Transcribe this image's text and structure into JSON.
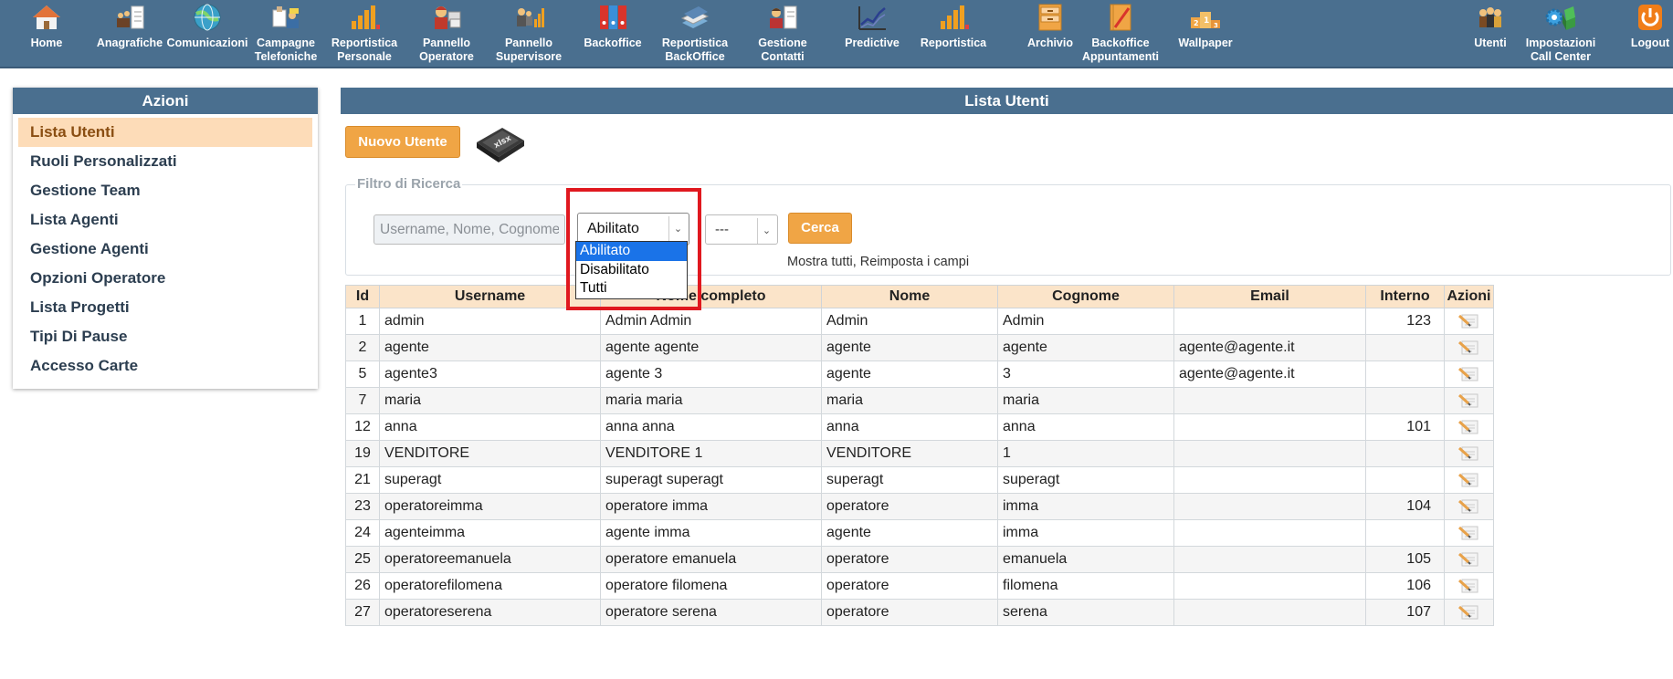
{
  "nav": {
    "items": [
      {
        "label": "Home",
        "icon": "home-icon"
      },
      {
        "label": "Anagrafiche",
        "icon": "registry-icon"
      },
      {
        "label": "Comunicazioni",
        "icon": "globe-icon"
      },
      {
        "label": "Campagne\nTelefoniche",
        "icon": "campaign-icon"
      },
      {
        "label": "Reportistica\nPersonale",
        "icon": "bar-chart-icon"
      },
      {
        "label": "Pannello\nOperatore",
        "icon": "operator-icon"
      },
      {
        "label": "Pannello\nSupervisore",
        "icon": "supervisor-icon"
      },
      {
        "label": "Backoffice",
        "icon": "binders-icon"
      },
      {
        "label": "Reportistica\nBackOffice",
        "icon": "books-icon"
      },
      {
        "label": "Gestione\nContatti",
        "icon": "contacts-icon"
      },
      {
        "label": "Predictive",
        "icon": "line-chart-icon"
      },
      {
        "label": "Reportistica",
        "icon": "bar-chart-icon"
      },
      {
        "label": "Archivio",
        "icon": "archive-icon"
      },
      {
        "label": "Backoffice\nAppuntamenti",
        "icon": "notebook-icon"
      },
      {
        "label": "Wallpaper",
        "icon": "podium-icon"
      },
      {
        "label": "Utenti",
        "icon": "users-icon"
      },
      {
        "label": "Impostazioni\nCall Center",
        "icon": "gears-icon"
      },
      {
        "label": "Logout",
        "icon": "power-icon"
      }
    ]
  },
  "sidebar": {
    "title": "Azioni",
    "items": [
      {
        "label": "Lista Utenti",
        "active": true
      },
      {
        "label": "Ruoli Personalizzati"
      },
      {
        "label": "Gestione Team"
      },
      {
        "label": "Lista Agenti"
      },
      {
        "label": "Gestione Agenti"
      },
      {
        "label": "Opzioni Operatore"
      },
      {
        "label": "Lista Progetti"
      },
      {
        "label": "Tipi Di Pause"
      },
      {
        "label": "Accesso Carte"
      }
    ]
  },
  "main": {
    "title": "Lista Utenti",
    "new_user_label": "Nuovo Utente",
    "export_icon": "xlsx-export-icon"
  },
  "filter": {
    "legend": "Filtro di Ricerca",
    "search_placeholder": "Username, Nome, Cognome",
    "status_value": "Abilitato",
    "status_options": [
      "Abilitato",
      "Disabilitato",
      "Tutti"
    ],
    "secondary_value": "---",
    "search_button": "Cerca",
    "show_all": "Mostra tutti",
    "separator": ", ",
    "reset": "Reimposta i campi"
  },
  "table": {
    "headers": [
      "Id",
      "Username",
      "Nome completo",
      "Nome",
      "Cognome",
      "Email",
      "Interno",
      "Azioni"
    ],
    "rows": [
      [
        "1",
        "admin",
        "Admin Admin",
        "Admin",
        "Admin",
        "",
        "123"
      ],
      [
        "2",
        "agente",
        "agente agente",
        "agente",
        "agente",
        "agente@agente.it",
        ""
      ],
      [
        "5",
        "agente3",
        "agente 3",
        "agente",
        "3",
        "agente@agente.it",
        ""
      ],
      [
        "7",
        "maria",
        "maria maria",
        "maria",
        "maria",
        "",
        ""
      ],
      [
        "12",
        "anna",
        "anna anna",
        "anna",
        "anna",
        "",
        "101"
      ],
      [
        "19",
        "VENDITORE",
        "VENDITORE 1",
        "VENDITORE",
        "1",
        "",
        ""
      ],
      [
        "21",
        "superagt",
        "superagt superagt",
        "superagt",
        "superagt",
        "",
        ""
      ],
      [
        "23",
        "operatoreimma",
        "operatore imma",
        "operatore",
        "imma",
        "",
        "104"
      ],
      [
        "24",
        "agenteimma",
        "agente imma",
        "agente",
        "imma",
        "",
        ""
      ],
      [
        "25",
        "operatoreemanuela",
        "operatore emanuela",
        "operatore",
        "emanuela",
        "",
        "105"
      ],
      [
        "26",
        "operatorefilomena",
        "operatore filomena",
        "operatore",
        "filomena",
        "",
        "106"
      ],
      [
        "27",
        "operatoreserena",
        "operatore serena",
        "operatore",
        "serena",
        "",
        "107"
      ]
    ],
    "action_icon": "edit-icon"
  },
  "colors": {
    "header_bar": "#4a6f8f",
    "accent_orange": "#f0a545",
    "active_item_bg": "#fddcb8",
    "table_header_bg": "#fbe4c9",
    "highlight_red": "#e0181f",
    "dropdown_selected": "#1a73e8"
  }
}
